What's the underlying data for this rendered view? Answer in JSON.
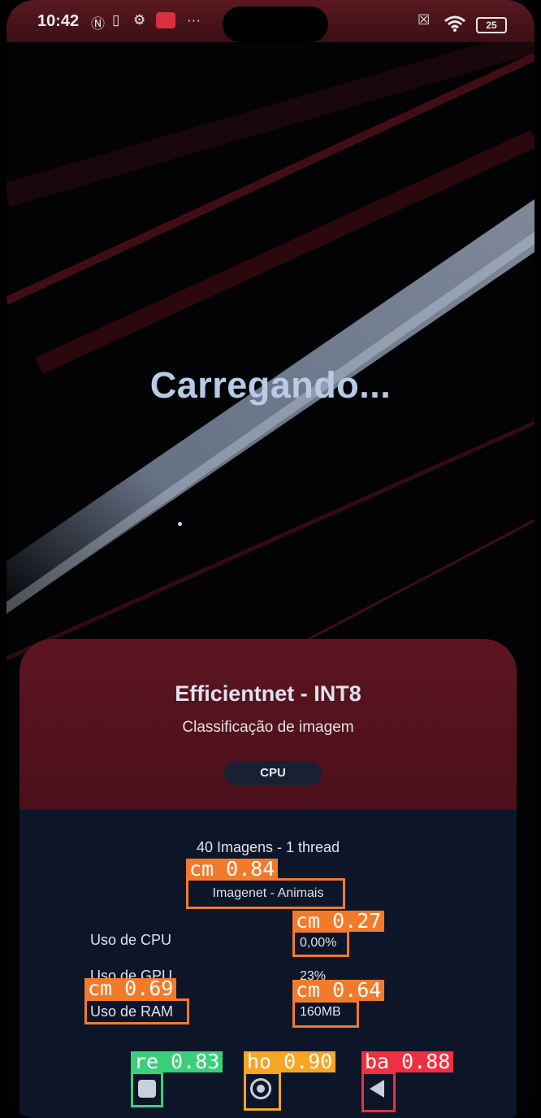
{
  "status_bar": {
    "time": "10:42",
    "icons": [
      "nfc-icon",
      "sim-icon",
      "settings-icon",
      "mail-icon",
      "more-icon",
      "no-sim-icon",
      "wifi-icon",
      "battery-icon"
    ],
    "more_glyph": "···",
    "battery": "25"
  },
  "loading": {
    "title": "Carregando..."
  },
  "card": {
    "model": "Efficientnet - INT8",
    "task": "Classificação de imagem",
    "device_chip": "CPU",
    "run_info": "40 Imagens - 1 thread",
    "dataset": "Imagenet - Animais",
    "metrics": [
      {
        "label": "Uso de CPU",
        "value": "0,00%"
      },
      {
        "label": "Uso de GPU",
        "value": "23%"
      },
      {
        "label": "Uso de RAM",
        "value": "160MB"
      }
    ]
  },
  "detections": [
    {
      "tag": "cm 0.84"
    },
    {
      "tag": "cm 0.27"
    },
    {
      "tag": "cm 0.69"
    },
    {
      "tag": "cm 0.64"
    },
    {
      "tag": "re 0.83"
    },
    {
      "tag": "ho 0.90"
    },
    {
      "tag": "ba 0.88"
    }
  ],
  "colors": {
    "card_top": "#4b101b",
    "card_bottom": "#0d1529",
    "title_text": "#b7cbe6",
    "overlay_orange": "#f47a2b",
    "overlay_green": "#3ccf7a",
    "overlay_yellow": "#f6a524",
    "overlay_red": "#ee3040"
  }
}
